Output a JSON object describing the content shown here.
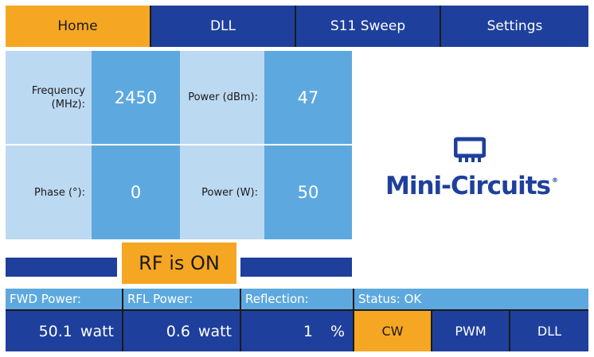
{
  "tabs": [
    {
      "label": "Home",
      "active": true
    },
    {
      "label": "DLL",
      "active": false
    },
    {
      "label": "S11 Sweep",
      "active": false
    },
    {
      "label": "Settings",
      "active": false
    }
  ],
  "params": {
    "frequency": {
      "label": "Frequency\n(MHz):",
      "value": "2450"
    },
    "power_dbm": {
      "label": "Power (dBm):",
      "value": "47"
    },
    "phase": {
      "label": "Phase (°):",
      "value": "0"
    },
    "power_w": {
      "label": "Power (W):",
      "value": "50"
    }
  },
  "rf_status": "RF is ON",
  "logo": {
    "text": "Mini-Circuits",
    "mark": "®",
    "icon": "chip-icon"
  },
  "meters": {
    "fwd": {
      "label": "FWD Power:",
      "value": "50.1",
      "unit": "watt"
    },
    "rfl": {
      "label": "RFL Power:",
      "value": "0.6",
      "unit": "watt"
    },
    "reflection": {
      "label": "Reflection:",
      "value": "1",
      "unit": "%"
    }
  },
  "status": "Status: OK",
  "modes": [
    {
      "label": "CW",
      "active": true
    },
    {
      "label": "PWM",
      "active": false
    },
    {
      "label": "DLL",
      "active": false
    }
  ],
  "colors": {
    "navy": "#1e3f9c",
    "orange": "#f5a623",
    "light_blue": "#bcd9f2",
    "mid_blue": "#5da9df"
  }
}
